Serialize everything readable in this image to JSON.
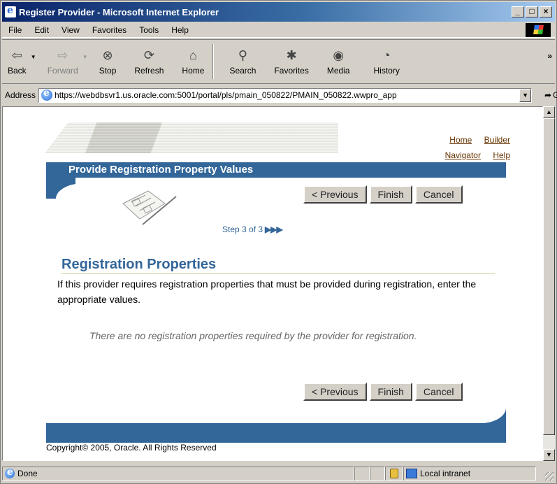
{
  "window": {
    "title": "Register Provider - Microsoft Internet Explorer"
  },
  "menu": [
    "File",
    "Edit",
    "View",
    "Favorites",
    "Tools",
    "Help"
  ],
  "toolbar": {
    "back": "Back",
    "forward": "Forward",
    "stop": "Stop",
    "refresh": "Refresh",
    "home": "Home",
    "search": "Search",
    "favorites": "Favorites",
    "media": "Media",
    "history": "History"
  },
  "address": {
    "label": "Address",
    "url": "https://webdbsvr1.us.oracle.com:5001/portal/pls/pmain_050822/PMAIN_050822.wwpro_app",
    "go": "Go"
  },
  "page": {
    "links": {
      "home": "Home",
      "builder": "Builder",
      "navigator": "Navigator",
      "help": "Help"
    },
    "header_title": "Provide Registration Property Values",
    "buttons": {
      "previous": "< Previous",
      "finish": "Finish",
      "cancel": "Cancel"
    },
    "step": "Step 3 of 3",
    "section_title": "Registration Properties",
    "section_desc": "If this provider requires registration properties that must be provided during registration, enter the appropriate values.",
    "no_props": "There are no registration properties required by the provider for registration.",
    "copyright": "Copyright© 2005, Oracle. All Rights Reserved"
  },
  "status": {
    "text": "Done",
    "zone": "Local intranet"
  },
  "icons": {
    "back": "back-arrow-icon",
    "forward": "forward-arrow-icon",
    "stop": "stop-icon",
    "refresh": "refresh-icon",
    "home": "home-icon",
    "search": "search-icon",
    "favorites": "favorites-icon",
    "media": "media-icon",
    "history": "history-icon"
  },
  "colors": {
    "header": "#336699",
    "link": "#663300",
    "title_gradient_start": "#0a246a"
  }
}
